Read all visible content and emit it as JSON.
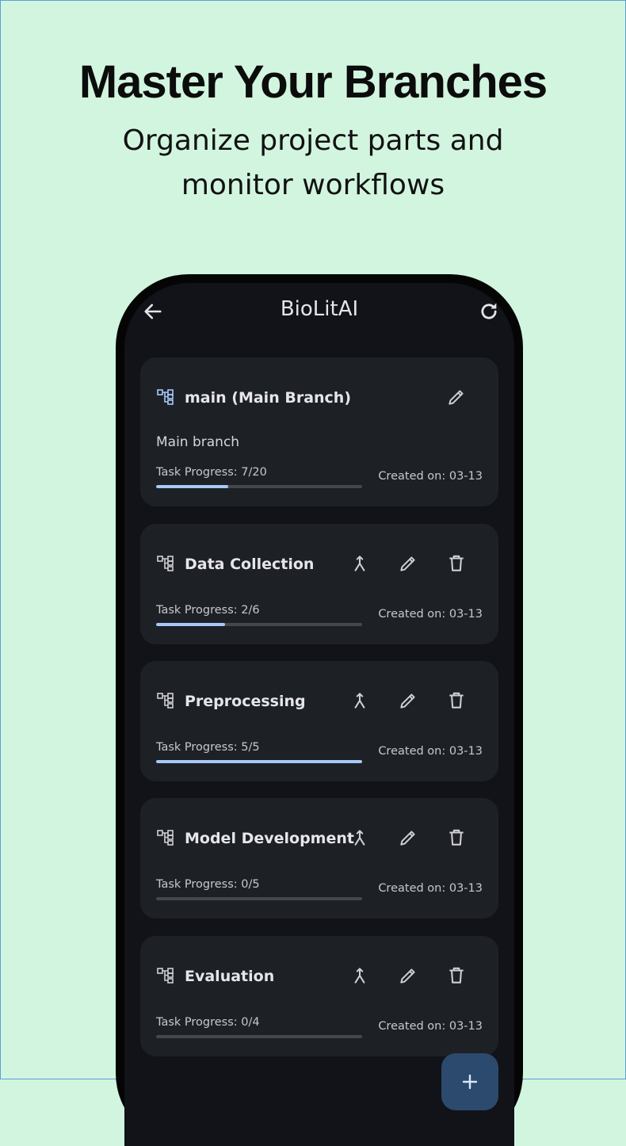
{
  "promo": {
    "headline": "Master Your Branches",
    "subline_1": "Organize project parts and",
    "subline_2": "monitor workflows"
  },
  "app": {
    "title": "BioLitAI",
    "back_icon": "arrow-left-icon",
    "refresh_icon": "refresh-icon"
  },
  "colors": {
    "background": "#d2f5e0",
    "screen": "#111318",
    "card": "#1d2025",
    "accent": "#a8c8fa",
    "fab": "#2b4a6e"
  },
  "branches": [
    {
      "name": "main (Main Branch)",
      "description": "Main branch",
      "progress_label": "Task Progress: 7/20",
      "progress_fraction": 0.35,
      "created": "Created on: 03-13",
      "actions": [
        "edit"
      ]
    },
    {
      "name": "Data Collection",
      "progress_label": "Task Progress: 2/6",
      "progress_fraction": 0.333,
      "created": "Created on: 03-13",
      "actions": [
        "merge",
        "edit",
        "delete"
      ]
    },
    {
      "name": "Preprocessing",
      "progress_label": "Task Progress: 5/5",
      "progress_fraction": 1.0,
      "created": "Created on: 03-13",
      "actions": [
        "merge",
        "edit",
        "delete"
      ]
    },
    {
      "name": "Model Development",
      "progress_label": "Task Progress: 0/5",
      "progress_fraction": 0.0,
      "created": "Created on: 03-13",
      "actions": [
        "merge",
        "edit",
        "delete"
      ]
    },
    {
      "name": "Evaluation",
      "progress_label": "Task Progress: 0/4",
      "progress_fraction": 0.0,
      "created": "Created on: 03-13",
      "actions": [
        "merge",
        "edit",
        "delete"
      ]
    }
  ],
  "fab": {
    "icon": "plus-icon"
  }
}
